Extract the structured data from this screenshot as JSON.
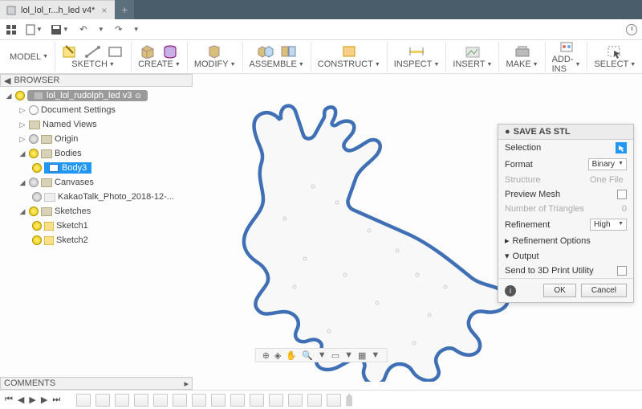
{
  "titlebar": {
    "tab_title": "lol_lol_r...h_led v4*"
  },
  "toolbar": {
    "model_label": "MODEL",
    "groups": [
      {
        "id": "sketch",
        "label": "SKETCH"
      },
      {
        "id": "create",
        "label": "CREATE"
      },
      {
        "id": "modify",
        "label": "MODIFY"
      },
      {
        "id": "assemble",
        "label": "ASSEMBLE"
      },
      {
        "id": "construct",
        "label": "CONSTRUCT"
      },
      {
        "id": "inspect",
        "label": "INSPECT"
      },
      {
        "id": "insert",
        "label": "INSERT"
      },
      {
        "id": "make",
        "label": "MAKE"
      },
      {
        "id": "addins",
        "label": "ADD-INS"
      },
      {
        "id": "select",
        "label": "SELECT"
      }
    ]
  },
  "browser": {
    "header": "BROWSER",
    "root": "lol_lol_rudolph_led v3",
    "nodes": {
      "doc_settings": "Document Settings",
      "named_views": "Named Views",
      "origin": "Origin",
      "bodies": "Bodies",
      "body3": "Body3",
      "canvases": "Canvases",
      "canvas1": "KakaoTalk_Photo_2018-12-...",
      "sketches": "Sketches",
      "sketch1": "Sketch1",
      "sketch2": "Sketch2"
    }
  },
  "dialog": {
    "title": "SAVE AS STL",
    "rows": {
      "selection": "Selection",
      "format": "Format",
      "format_value": "Binary",
      "structure": "Structure",
      "structure_value": "One File",
      "preview_mesh": "Preview Mesh",
      "num_tri": "Number of Triangles",
      "num_tri_value": "0",
      "refinement": "Refinement",
      "refinement_value": "High",
      "ref_options": "Refinement Options",
      "output": "Output",
      "send_3d": "Send to 3D Print Utility"
    },
    "ok": "OK",
    "cancel": "Cancel"
  },
  "comments": {
    "header": "COMMENTS"
  }
}
